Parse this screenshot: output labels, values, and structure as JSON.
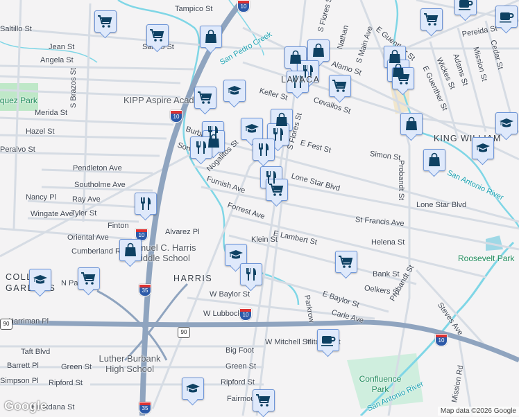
{
  "map": {
    "attribution": "Map data ©2026 Google",
    "logo": "Google",
    "colors": {
      "background": "#f4f3f4",
      "road": "#d6dce4",
      "highway": "#8fa4bf",
      "water": "#7fd6e6",
      "park": "#bfe8c8",
      "marker_fill": "#dfe9fb",
      "marker_icon": "#0e4163"
    },
    "labels": {
      "streets": [
        "Tampico St",
        "Saltillo St",
        "Jean St",
        "Angela St",
        "Saltillo St",
        "S Brazos St",
        "Merida St",
        "Hazel St",
        "Peralvo St",
        "Pendleton Ave",
        "Southolme Ave",
        "Nancy Pl",
        "Ray Ave",
        "Wingate Ave",
        "Tyler St",
        "Finton",
        "Oriental Ave",
        "Cumberland Rd",
        "Alvarez Pl",
        "Furnish Ave",
        "Forrest Ave",
        "Klein St",
        "E Lambert St",
        "Helena St",
        "St Francis Ave",
        "Lone Star Blvd",
        "Lone Star Blvd",
        "Bank St",
        "Oelkers St",
        "E Baylor St",
        "Parkrow",
        "Carle Ave",
        "W Baylor St",
        "W Lubbock St",
        "Harriman Pl",
        "Taft Blvd",
        "Green St",
        "Barrett Pl",
        "Big Foot",
        "Green St",
        "Ripford St",
        "Ripford St",
        "Fairmount",
        "Mitchell St",
        "W Mitchell St",
        "Probandt St",
        "Probandt St",
        "Steves Ave",
        "Mission Rd",
        "Simon St",
        "E Fest St",
        "Keller St",
        "Cevallos St",
        "Alamo St",
        "S Flores St",
        "S Flores St",
        "Nathan",
        "S Main Ave",
        "E Guenther St",
        "E Guenther St",
        "Wickes St",
        "Adams St",
        "Mission St",
        "Cedar St",
        "Pereida St",
        "Burbank",
        "Sonora",
        "Nogalitos St",
        "N Park",
        "Simpson Pl",
        "Buckdana St"
      ],
      "places": [
        "KIPP Aspire Academy",
        "Samuel C. Harris Middle School",
        "Luther Burbank High School"
      ],
      "neighborhoods": [
        "HARRIS",
        "KING WILLIAM",
        "LAVACA",
        "COLLINS GARDENS"
      ],
      "parks": [
        "Vasquez Park",
        "Confluence Park",
        "Roosevelt Park"
      ],
      "water": [
        "San Pedro Creek",
        "San Antonio River",
        "San Antonio River"
      ],
      "shields": [
        "10",
        "10",
        "10",
        "10",
        "10",
        "35",
        "35",
        "90",
        "90"
      ]
    },
    "markers": {
      "grocery": 9,
      "shopping": 7,
      "restaurant": 8,
      "school": 7,
      "cafe": 3
    }
  }
}
